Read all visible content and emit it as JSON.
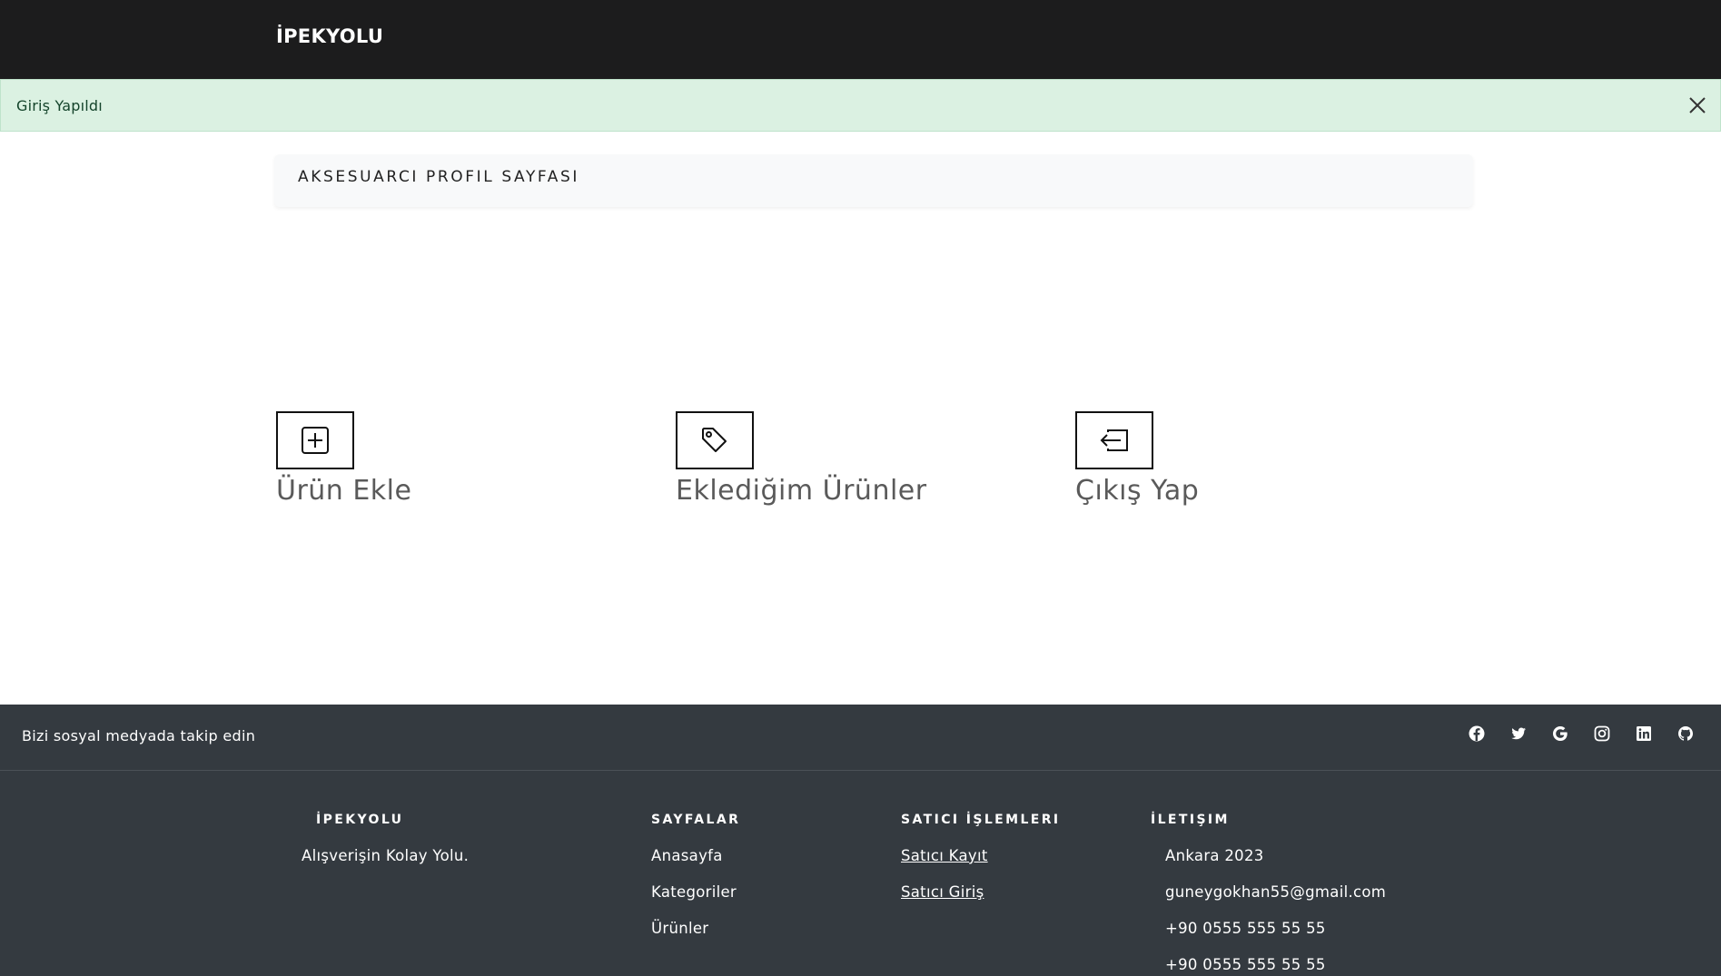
{
  "navbar": {
    "brand": "İPEKYOLU"
  },
  "alert": {
    "message": "Giriş Yapıldı",
    "close_icon": "close-icon"
  },
  "profile": {
    "title": "AKSESUARCI PROFIL SAYFASI"
  },
  "actions": [
    {
      "label": "Ürün Ekle",
      "icon": "plus-square-icon"
    },
    {
      "label": "Eklediğim Ürünler",
      "icon": "tag-icon"
    },
    {
      "label": "Çıkış Yap",
      "icon": "box-arrow-left-icon"
    }
  ],
  "social": {
    "text": "Bizi sosyal medyada takip edin",
    "icons": [
      "facebook-icon",
      "twitter-icon",
      "google-icon",
      "instagram-icon",
      "linkedin-icon",
      "github-icon"
    ]
  },
  "footer": {
    "brand": {
      "title": "İPEKYOLU",
      "tagline": "Alışverişin Kolay Yolu."
    },
    "pages": {
      "title": "SAYFALAR",
      "items": [
        "Anasayfa",
        "Kategoriler",
        "Ürünler"
      ]
    },
    "seller": {
      "title": "SATICI İŞLEMLERI",
      "items": [
        "Satıcı Kayıt",
        "Satıcı Giriş"
      ]
    },
    "contact": {
      "title": "İLETIŞIM",
      "items": [
        "Ankara 2023",
        "guneygokhan55@gmail.com",
        "+90 0555 555 55 55",
        "+90 0555 555 55 55"
      ]
    }
  },
  "colors": {
    "navbar": "#1c1c1d",
    "alert_bg": "#dbf1e2",
    "footer_bg": "#343a40"
  }
}
